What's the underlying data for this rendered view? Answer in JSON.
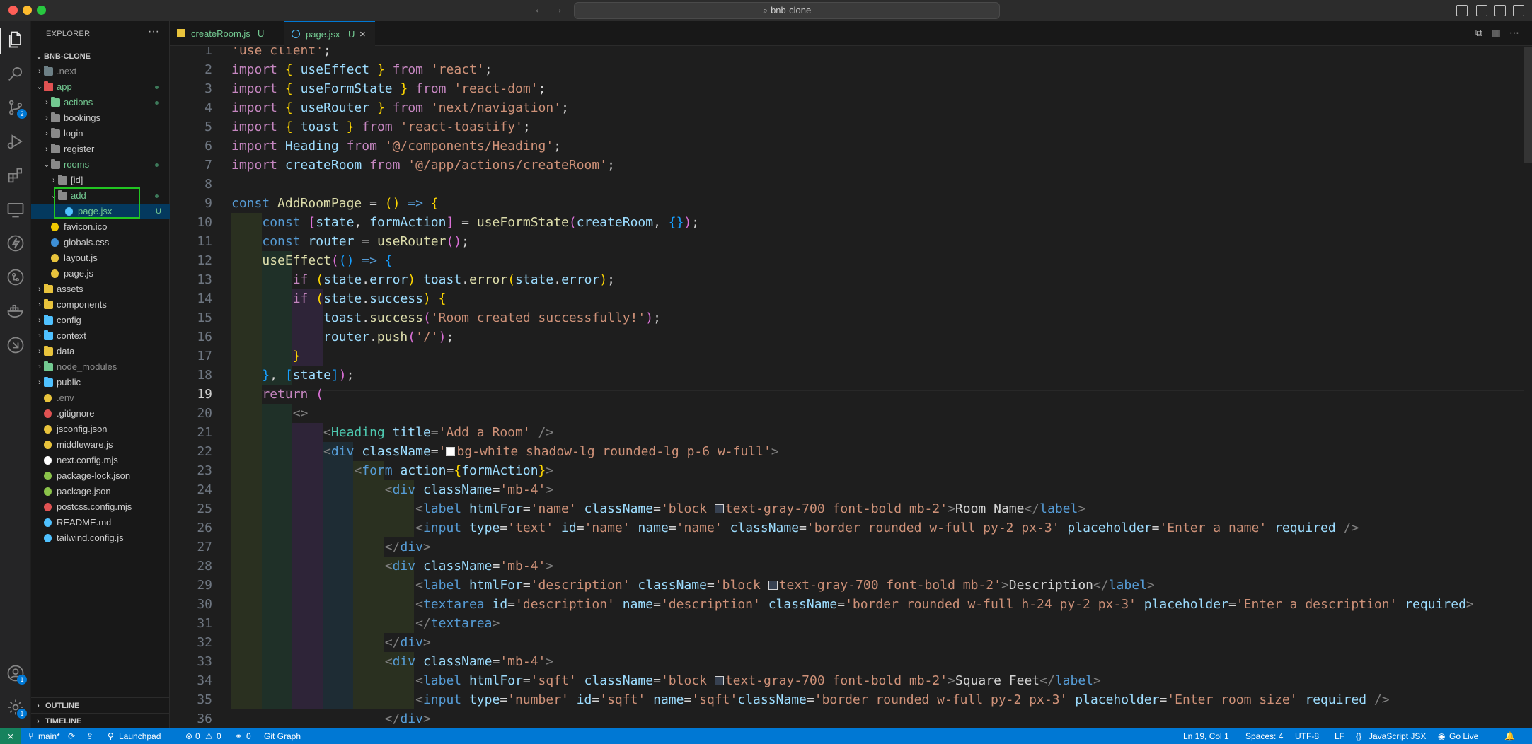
{
  "titlebar": {
    "search": "bnb-clone"
  },
  "explorer": {
    "title": "EXPLORER",
    "more": "···",
    "root": "BNB-CLONE",
    "items": [
      {
        "label": ".next",
        "color": "#8c8c8c"
      },
      {
        "label": "app",
        "color": "#73c991"
      },
      {
        "label": "actions",
        "color": "#73c991"
      },
      {
        "label": "bookings",
        "color": "#cccccc"
      },
      {
        "label": "login",
        "color": "#cccccc"
      },
      {
        "label": "register",
        "color": "#cccccc"
      },
      {
        "label": "rooms",
        "color": "#73c991"
      },
      {
        "label": "[id]",
        "color": "#cccccc"
      },
      {
        "label": "add",
        "color": "#73c991"
      },
      {
        "label": "page.jsx",
        "color": "#73c991",
        "mark": "U"
      },
      {
        "label": "favicon.ico",
        "color": "#cccccc"
      },
      {
        "label": "globals.css",
        "color": "#cccccc"
      },
      {
        "label": "layout.js",
        "color": "#cccccc"
      },
      {
        "label": "page.js",
        "color": "#cccccc"
      },
      {
        "label": "assets",
        "color": "#cccccc"
      },
      {
        "label": "components",
        "color": "#cccccc"
      },
      {
        "label": "config",
        "color": "#cccccc"
      },
      {
        "label": "context",
        "color": "#cccccc"
      },
      {
        "label": "data",
        "color": "#cccccc"
      },
      {
        "label": "node_modules",
        "color": "#8c8c8c"
      },
      {
        "label": "public",
        "color": "#cccccc"
      },
      {
        "label": ".env",
        "color": "#8c8c8c"
      },
      {
        "label": ".gitignore",
        "color": "#cccccc"
      },
      {
        "label": "jsconfig.json",
        "color": "#cccccc"
      },
      {
        "label": "middleware.js",
        "color": "#cccccc"
      },
      {
        "label": "next.config.mjs",
        "color": "#cccccc"
      },
      {
        "label": "package-lock.json",
        "color": "#cccccc"
      },
      {
        "label": "package.json",
        "color": "#cccccc"
      },
      {
        "label": "postcss.config.mjs",
        "color": "#cccccc"
      },
      {
        "label": "README.md",
        "color": "#cccccc"
      },
      {
        "label": "tailwind.config.js",
        "color": "#cccccc"
      }
    ],
    "outline": "OUTLINE",
    "timeline": "TIMELINE"
  },
  "activity_badges": {
    "source_control": "2",
    "accounts": "1",
    "settings": "1"
  },
  "tabs": [
    {
      "label": "createRoom.js",
      "status": "U",
      "icon": "js-file-icon"
    },
    {
      "label": "page.jsx",
      "status": "U",
      "icon": "react-file-icon",
      "close": "×"
    }
  ],
  "editor": {
    "line_numbers": [
      "1",
      "2",
      "3",
      "4",
      "5",
      "6",
      "7",
      "8",
      "9",
      "10",
      "11",
      "12",
      "13",
      "14",
      "15",
      "16",
      "17",
      "18",
      "19",
      "20",
      "21",
      "22",
      "23",
      "24",
      "25",
      "26",
      "27",
      "28",
      "29",
      "30",
      "31",
      "32",
      "33",
      "34",
      "35",
      "36"
    ],
    "current_line": "19"
  },
  "statusbar": {
    "branch": "main*",
    "launchpad": "Launchpad",
    "errors": "0",
    "warnings": "0",
    "ports": "0",
    "git_graph": "Git Graph",
    "position": "Ln 19, Col 1",
    "spaces": "Spaces: 4",
    "encoding": "UTF-8",
    "eol": "LF",
    "language": "JavaScript JSX",
    "go_live": "Go Live"
  }
}
